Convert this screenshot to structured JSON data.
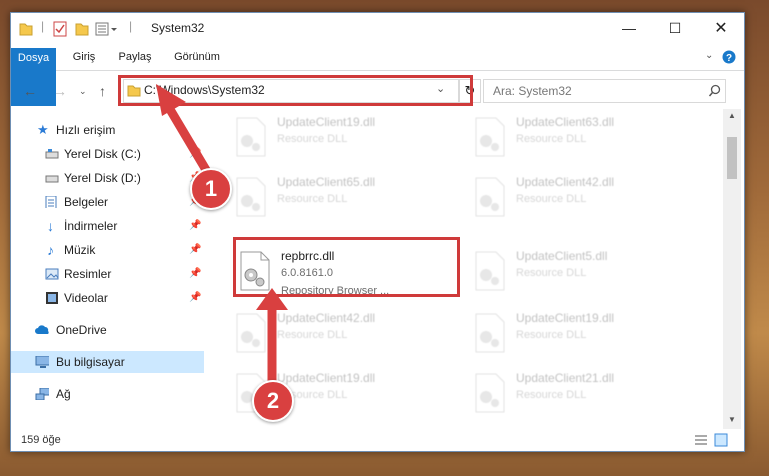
{
  "window": {
    "title": "System32"
  },
  "ribbon": {
    "tabs": [
      "Dosya",
      "Giriş",
      "Paylaş",
      "Görünüm"
    ]
  },
  "address": {
    "path": "C:\\Windows\\System32",
    "search_placeholder": "Ara: System32"
  },
  "nav": {
    "items": [
      {
        "label": "Hızlı erişim",
        "icon": "star-icon"
      },
      {
        "label": "Yerel Disk (C:)",
        "icon": "drive-icon",
        "pinned": true
      },
      {
        "label": "Yerel Disk (D:)",
        "icon": "drive-icon",
        "pinned": true
      },
      {
        "label": "Belgeler",
        "icon": "documents-icon",
        "pinned": true
      },
      {
        "label": "İndirmeler",
        "icon": "download-icon",
        "pinned": true
      },
      {
        "label": "Müzik",
        "icon": "music-icon",
        "pinned": true
      },
      {
        "label": "Resimler",
        "icon": "pictures-icon",
        "pinned": true
      },
      {
        "label": "Videolar",
        "icon": "videos-icon",
        "pinned": true
      },
      {
        "label": "OneDrive",
        "icon": "cloud-icon"
      },
      {
        "label": "Bu bilgisayar",
        "icon": "computer-icon",
        "selected": true
      },
      {
        "label": "Ağ",
        "icon": "network-icon"
      }
    ]
  },
  "files": [
    {
      "name": "UpdateClient19.dll",
      "desc": "Resource DLL"
    },
    {
      "name": "UpdateClient63.dll",
      "desc": "Resource DLL"
    },
    {
      "name": "UpdateClient65.dll",
      "desc": "Resource DLL"
    },
    {
      "name": "UpdateClient42.dll",
      "desc": "Resource DLL"
    },
    {
      "name": "repbrrc.dll",
      "desc": "6.0.8161.0",
      "sub": "Repository Browser ..."
    },
    {
      "name": "UpdateClient5.dll",
      "desc": "Resource DLL"
    },
    {
      "name": "UpdateClient42.dll",
      "desc": "Resource DLL"
    },
    {
      "name": "UpdateClient19.dll",
      "desc": "Resource DLL"
    },
    {
      "name": "UpdateClient19.dll",
      "desc": "Resource DLL"
    },
    {
      "name": "UpdateClient21.dll",
      "desc": "Resource DLL"
    }
  ],
  "status": {
    "count": "159 öğe"
  },
  "callouts": [
    "1",
    "2"
  ],
  "colors": {
    "accent": "#1979ca",
    "highlight": "#cf3a3a",
    "selected": "#cce8ff"
  }
}
